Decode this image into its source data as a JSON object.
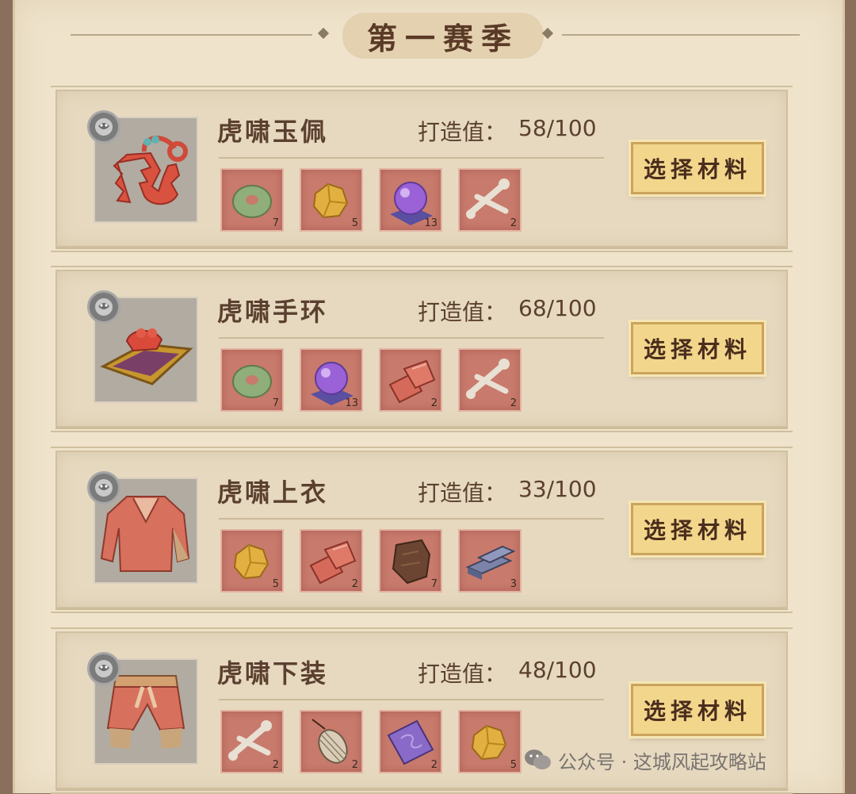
{
  "season_title": "第一赛季",
  "forge_label": "打造值：",
  "select_button_label": "选择材料",
  "items": [
    {
      "name": "虎啸玉佩",
      "forge_value": "58/100",
      "icon": "jade-pendant-icon",
      "materials": [
        {
          "icon": "jade-disc-icon",
          "qty": "7"
        },
        {
          "icon": "gold-ore-icon",
          "qty": "5"
        },
        {
          "icon": "purple-orb-icon",
          "qty": "13"
        },
        {
          "icon": "bone-icon",
          "qty": "2"
        }
      ]
    },
    {
      "name": "虎啸手环",
      "forge_value": "68/100",
      "icon": "bracelet-icon",
      "materials": [
        {
          "icon": "jade-disc-icon",
          "qty": "7"
        },
        {
          "icon": "purple-orb-icon",
          "qty": "13"
        },
        {
          "icon": "red-fabric-icon",
          "qty": "2"
        },
        {
          "icon": "bone-icon",
          "qty": "2"
        }
      ]
    },
    {
      "name": "虎啸上衣",
      "forge_value": "33/100",
      "icon": "robe-icon",
      "materials": [
        {
          "icon": "gold-ore-icon",
          "qty": "5"
        },
        {
          "icon": "red-fabric-icon",
          "qty": "2"
        },
        {
          "icon": "leather-hide-icon",
          "qty": "7"
        },
        {
          "icon": "iron-ingot-icon",
          "qty": "3"
        }
      ]
    },
    {
      "name": "虎啸下装",
      "forge_value": "48/100",
      "icon": "trousers-icon",
      "materials": [
        {
          "icon": "bone-icon",
          "qty": "2"
        },
        {
          "icon": "thread-spool-icon",
          "qty": "2"
        },
        {
          "icon": "purple-cloth-icon",
          "qty": "2"
        },
        {
          "icon": "gold-ore-icon",
          "qty": "5"
        }
      ]
    }
  ],
  "watermark": "公众号 · 这城风起攻略站",
  "colors": {
    "background": "#efe3cb",
    "card": "#e6d9bf",
    "material_slot": "#c87a6c",
    "button": "#f2d68c",
    "text": "#5b4030"
  }
}
